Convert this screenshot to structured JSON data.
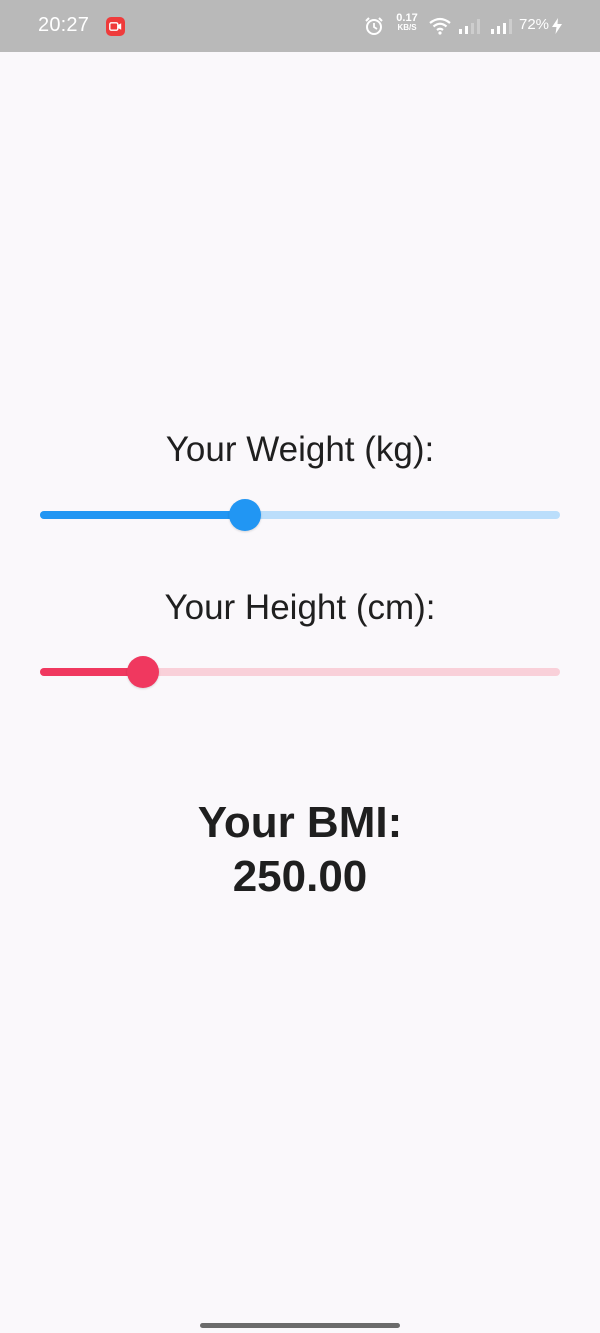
{
  "status_bar": {
    "time": "20:27",
    "net_speed_value": "0.17",
    "net_speed_unit": "KB/S",
    "battery": "72%",
    "icons": [
      "screen-record-icon",
      "alarm-icon",
      "wifi-icon",
      "signal-icon",
      "signal-icon",
      "charging-icon"
    ]
  },
  "weight": {
    "label": "Your Weight (kg):",
    "slider_fraction": 0.394,
    "active_color": "#2196f3",
    "inactive_color": "#bbdefb"
  },
  "height": {
    "label": "Your Height (cm):",
    "slider_fraction": 0.198,
    "active_color": "#f0385f",
    "inactive_color": "#f9d0d9"
  },
  "bmi": {
    "title": "Your BMI:",
    "value": "250.00"
  }
}
